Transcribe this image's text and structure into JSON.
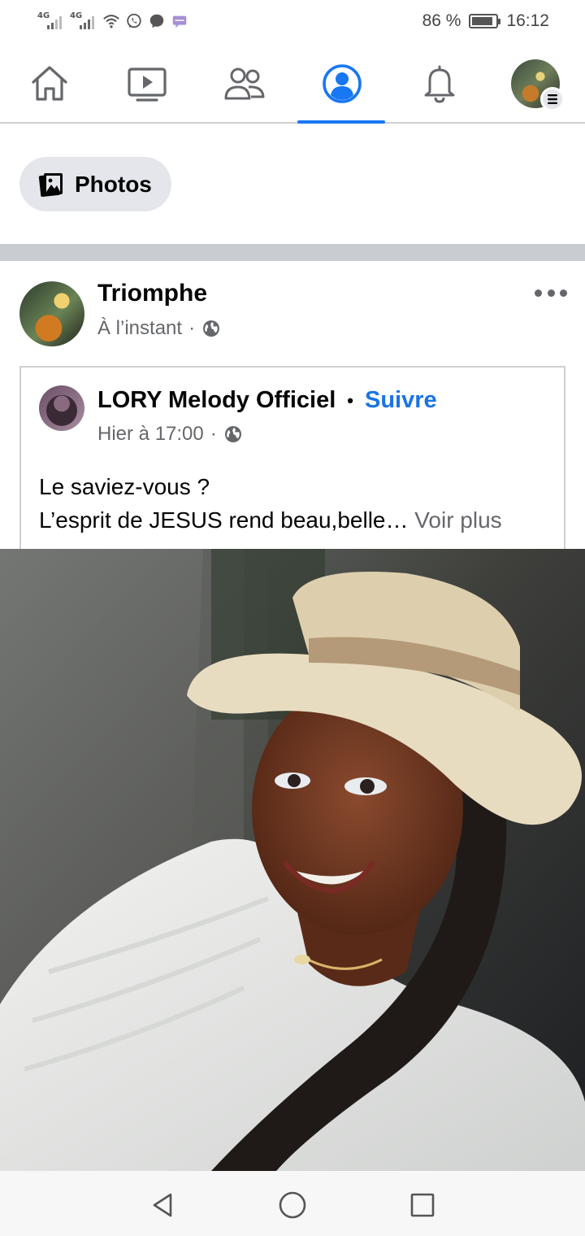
{
  "status_bar": {
    "network_1": "4G",
    "network_2": "4G",
    "battery_percent": "86 %",
    "battery_level": 0.86,
    "time": "16:12",
    "icons": [
      "signal-icon",
      "signal-icon",
      "wifi-icon",
      "whatsapp-icon",
      "messenger-icon",
      "message-icon"
    ]
  },
  "nav": {
    "tabs": [
      {
        "name": "home",
        "icon": "home-icon"
      },
      {
        "name": "watch",
        "icon": "video-icon"
      },
      {
        "name": "friends",
        "icon": "friends-icon"
      },
      {
        "name": "profile",
        "icon": "profile-icon",
        "active": true
      },
      {
        "name": "notifications",
        "icon": "bell-icon"
      },
      {
        "name": "menu",
        "icon": "menu-icon"
      }
    ],
    "accent_color": "#1877f2"
  },
  "filter_chip": {
    "label": "Photos",
    "icon": "photos-icon"
  },
  "post": {
    "author": "Triomphe",
    "timestamp": "À l’instant",
    "separator": "·",
    "privacy_icon": "globe-icon",
    "more_icon": "more-options-icon",
    "shared": {
      "author": "LORY Melody Officiel",
      "bullet": "•",
      "follow_label": "Suivre",
      "timestamp": "Hier à 17:00",
      "separator": "·",
      "privacy_icon": "globe-icon",
      "text_line_1": "Le saviez-vous ?",
      "text_line_2": "L’esprit de JESUS rend beau,belle…",
      "see_more_label": "Voir plus"
    }
  },
  "system_nav": {
    "buttons": [
      "back-icon",
      "home-circle-icon",
      "recents-icon"
    ]
  }
}
